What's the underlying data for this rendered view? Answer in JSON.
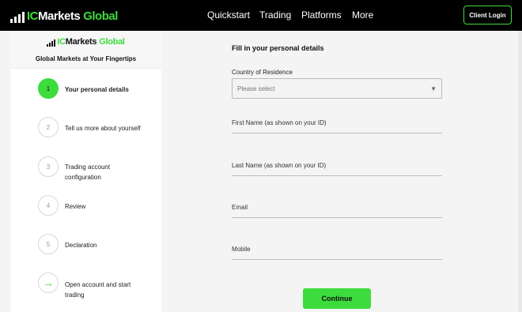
{
  "brand": {
    "ic": "IC",
    "markets": "Markets",
    "global": "Global"
  },
  "nav": {
    "items": [
      "Quickstart",
      "Trading",
      "Platforms",
      "More"
    ],
    "login": "Client Login"
  },
  "sidebar": {
    "logo": {
      "ic": "IC",
      "markets": "Markets",
      "global": "Global"
    },
    "tagline": "Global Markets at Your Fingertips",
    "steps": [
      {
        "num": "1",
        "label": "Your personal details"
      },
      {
        "num": "2",
        "label": "Tell us more about yourself"
      },
      {
        "num": "3",
        "label": "Trading account configuration"
      },
      {
        "num": "4",
        "label": "Review"
      },
      {
        "num": "5",
        "label": "Declaration"
      },
      {
        "num": "→",
        "label": "Open account and start trading"
      }
    ]
  },
  "form": {
    "title": "Fill in your personal details",
    "country_label": "Country of Residence",
    "country_placeholder": "Please select",
    "first_name": "First Name (as shown on your ID)",
    "last_name": "Last Name (as shown on your ID)",
    "email": "Email",
    "mobile": "Mobile",
    "continue": "Continue"
  },
  "colors": {
    "accent": "#3ddc3d",
    "topbar": "#000000"
  }
}
